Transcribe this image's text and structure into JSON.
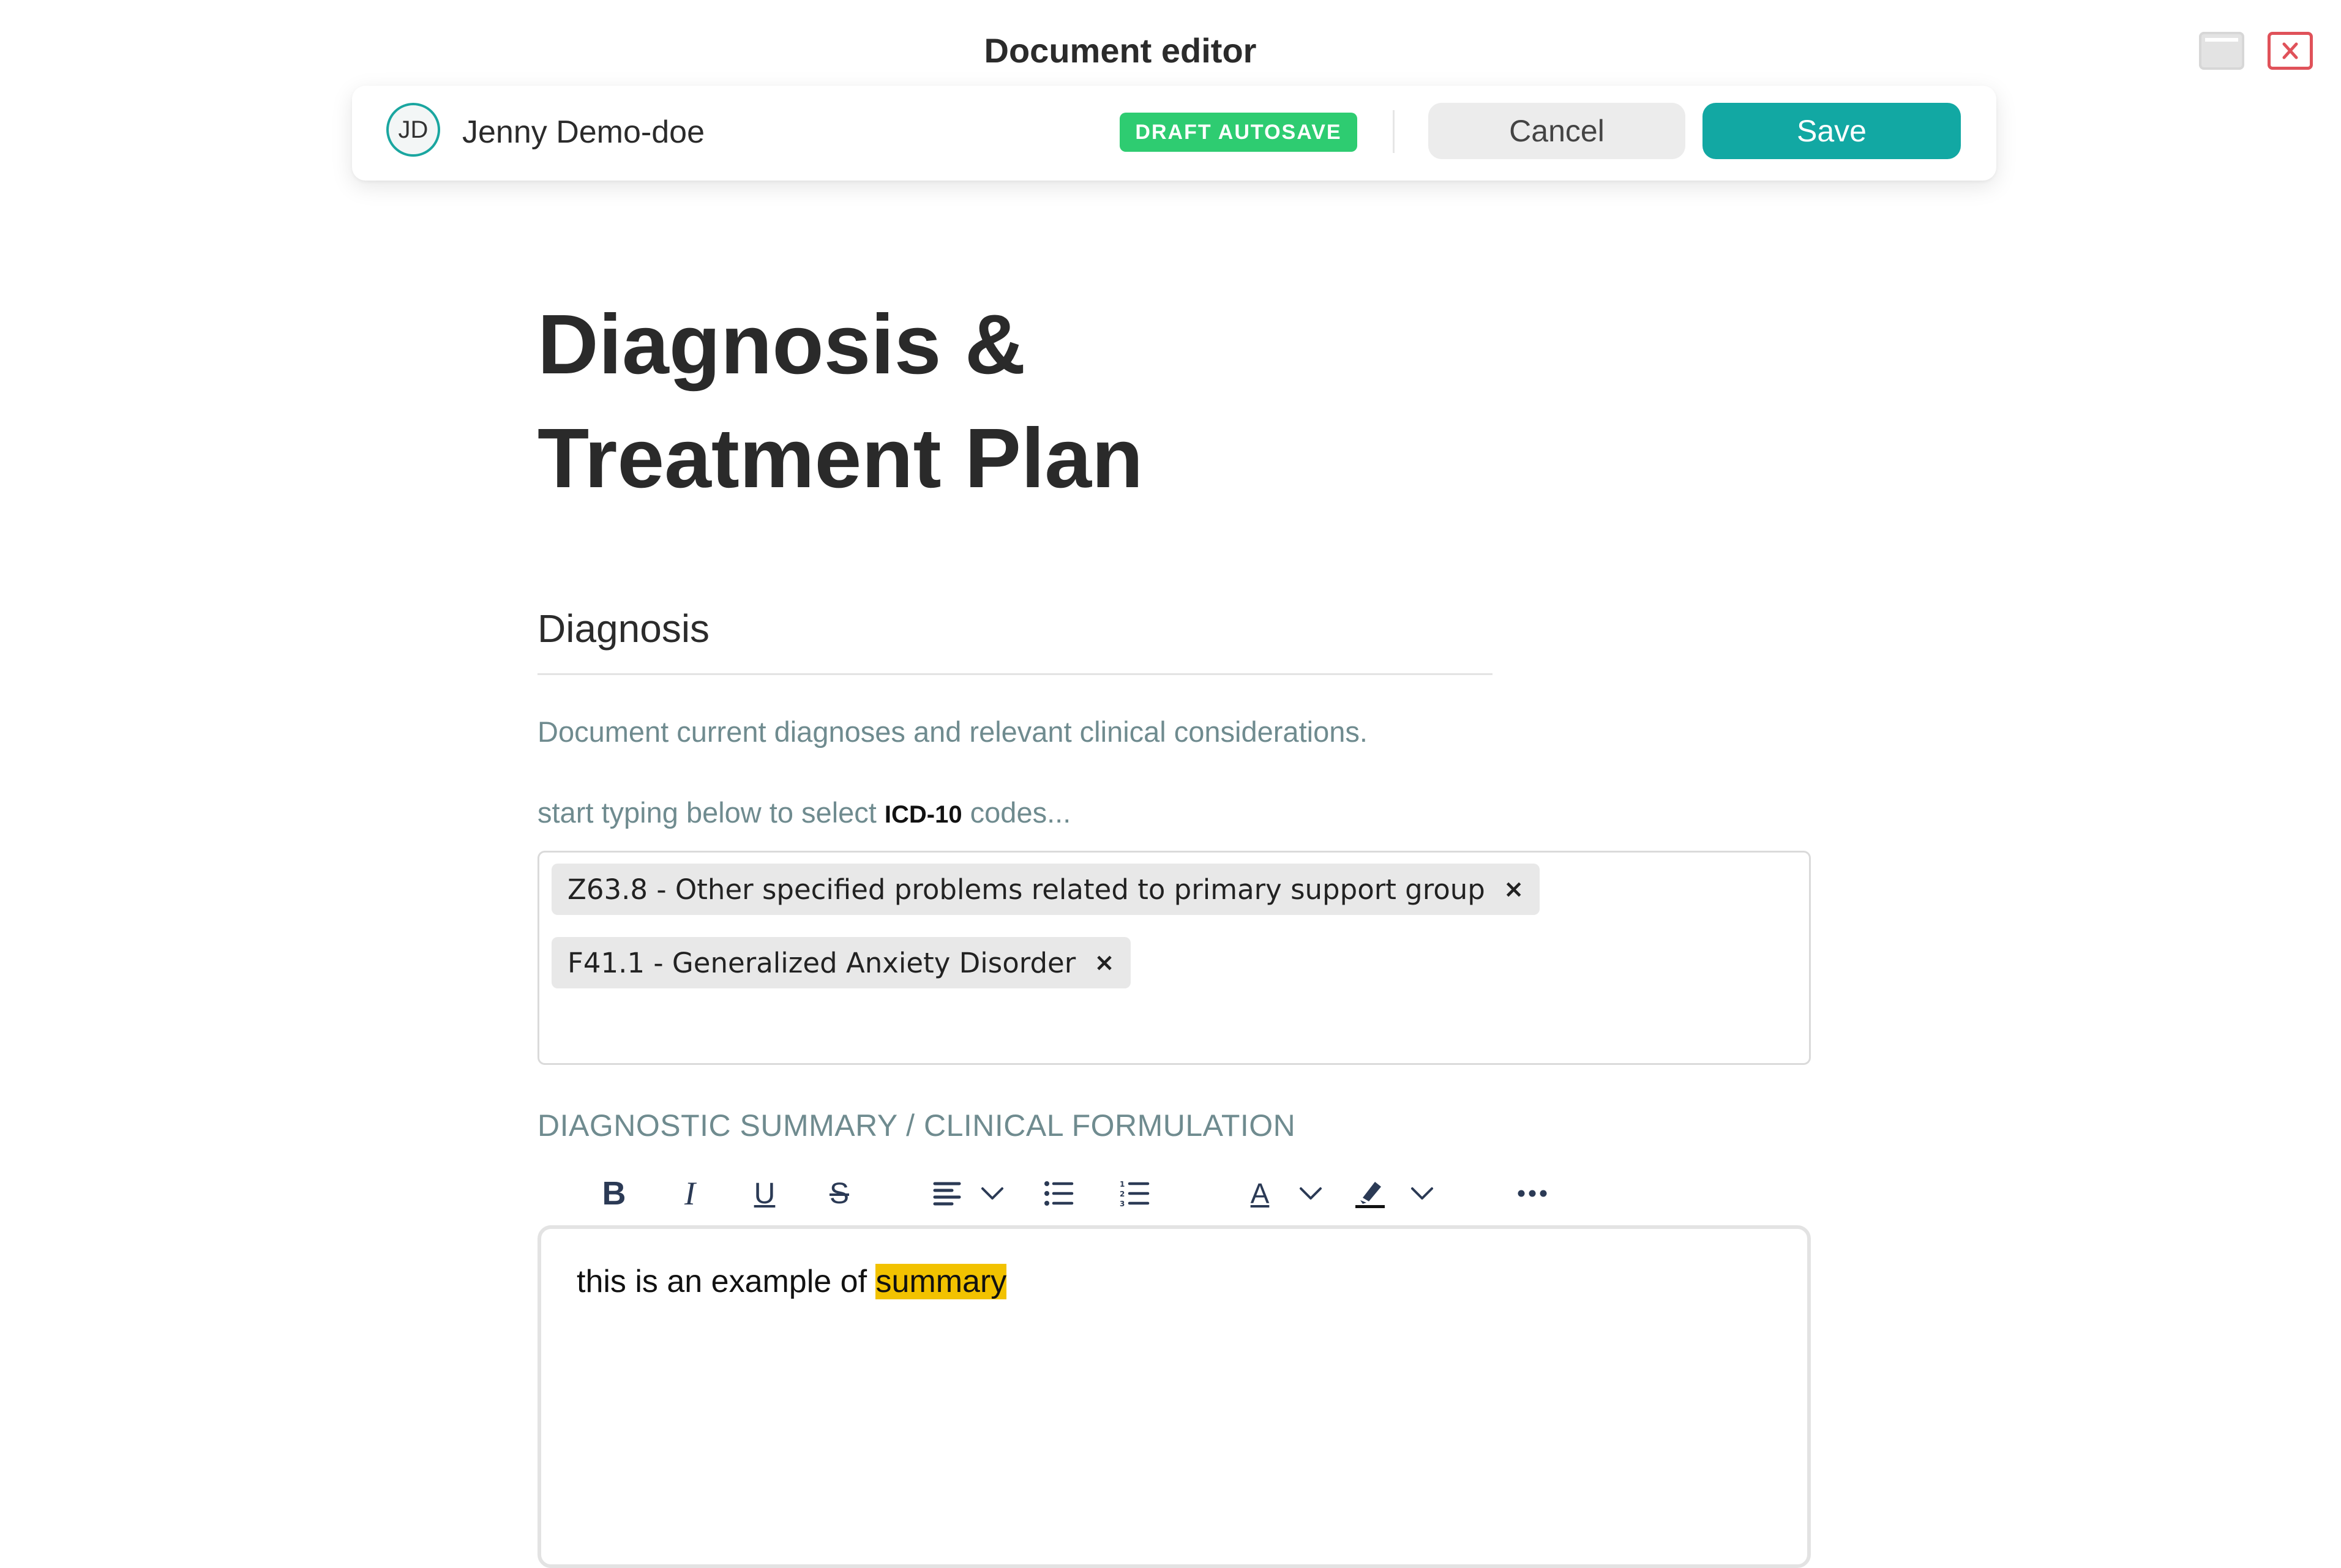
{
  "window": {
    "title": "Document editor",
    "controls": [
      "maximize",
      "close"
    ],
    "close_color": "#e0525a"
  },
  "topbar": {
    "user_initials": "JD",
    "user_name": "Jenny Demo-doe",
    "status_badge": "DRAFT AUTOSAVE",
    "cancel_label": "Cancel",
    "save_label": "Save",
    "accent_color": "#12a8a3",
    "badge_color": "#2ecc71"
  },
  "document": {
    "title_line1": "Diagnosis &",
    "title_line2": "Treatment Plan",
    "section_heading": "Diagnosis",
    "section_description": "Document current diagnoses and relevant clinical considerations.",
    "codes_hint_prefix": "start typing below to select",
    "codes_hint_code": "ICD-10",
    "codes_hint_suffix": "codes...",
    "selected_codes": [
      {
        "label": "Z63.8 - Other specified problems related to primary support group"
      },
      {
        "label": "F41.1 - Generalized Anxiety Disorder"
      }
    ],
    "remove_glyph": "×",
    "summary_label": "DIAGNOSTIC SUMMARY / CLINICAL FORMULATION",
    "editor_text_before": "this is an example of ",
    "editor_text_highlighted": "summary",
    "highlight_color": "#f2c200"
  },
  "toolbar": {
    "items": [
      {
        "name": "bold",
        "label": "B"
      },
      {
        "name": "italic",
        "label": "I"
      },
      {
        "name": "underline",
        "label": "U"
      },
      {
        "name": "strikethrough",
        "label": "S"
      },
      {
        "name": "align",
        "icon": "align-left-icon"
      },
      {
        "name": "bullet-list",
        "icon": "bullet-list-icon"
      },
      {
        "name": "numbered-list",
        "icon": "numbered-list-icon"
      },
      {
        "name": "text-color",
        "label": "A"
      },
      {
        "name": "highlight",
        "icon": "highlighter-icon"
      },
      {
        "name": "more",
        "icon": "more-icon"
      }
    ]
  }
}
